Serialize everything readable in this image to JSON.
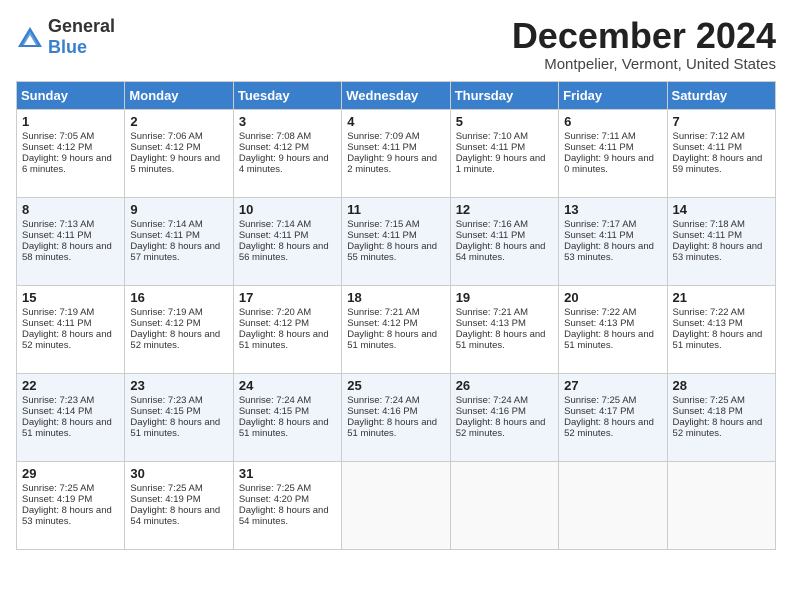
{
  "header": {
    "logo_general": "General",
    "logo_blue": "Blue",
    "month": "December 2024",
    "location": "Montpelier, Vermont, United States"
  },
  "days_of_week": [
    "Sunday",
    "Monday",
    "Tuesday",
    "Wednesday",
    "Thursday",
    "Friday",
    "Saturday"
  ],
  "weeks": [
    [
      {
        "day": 1,
        "sunrise": "Sunrise: 7:05 AM",
        "sunset": "Sunset: 4:12 PM",
        "daylight": "Daylight: 9 hours and 6 minutes."
      },
      {
        "day": 2,
        "sunrise": "Sunrise: 7:06 AM",
        "sunset": "Sunset: 4:12 PM",
        "daylight": "Daylight: 9 hours and 5 minutes."
      },
      {
        "day": 3,
        "sunrise": "Sunrise: 7:08 AM",
        "sunset": "Sunset: 4:12 PM",
        "daylight": "Daylight: 9 hours and 4 minutes."
      },
      {
        "day": 4,
        "sunrise": "Sunrise: 7:09 AM",
        "sunset": "Sunset: 4:11 PM",
        "daylight": "Daylight: 9 hours and 2 minutes."
      },
      {
        "day": 5,
        "sunrise": "Sunrise: 7:10 AM",
        "sunset": "Sunset: 4:11 PM",
        "daylight": "Daylight: 9 hours and 1 minute."
      },
      {
        "day": 6,
        "sunrise": "Sunrise: 7:11 AM",
        "sunset": "Sunset: 4:11 PM",
        "daylight": "Daylight: 9 hours and 0 minutes."
      },
      {
        "day": 7,
        "sunrise": "Sunrise: 7:12 AM",
        "sunset": "Sunset: 4:11 PM",
        "daylight": "Daylight: 8 hours and 59 minutes."
      }
    ],
    [
      {
        "day": 8,
        "sunrise": "Sunrise: 7:13 AM",
        "sunset": "Sunset: 4:11 PM",
        "daylight": "Daylight: 8 hours and 58 minutes."
      },
      {
        "day": 9,
        "sunrise": "Sunrise: 7:14 AM",
        "sunset": "Sunset: 4:11 PM",
        "daylight": "Daylight: 8 hours and 57 minutes."
      },
      {
        "day": 10,
        "sunrise": "Sunrise: 7:14 AM",
        "sunset": "Sunset: 4:11 PM",
        "daylight": "Daylight: 8 hours and 56 minutes."
      },
      {
        "day": 11,
        "sunrise": "Sunrise: 7:15 AM",
        "sunset": "Sunset: 4:11 PM",
        "daylight": "Daylight: 8 hours and 55 minutes."
      },
      {
        "day": 12,
        "sunrise": "Sunrise: 7:16 AM",
        "sunset": "Sunset: 4:11 PM",
        "daylight": "Daylight: 8 hours and 54 minutes."
      },
      {
        "day": 13,
        "sunrise": "Sunrise: 7:17 AM",
        "sunset": "Sunset: 4:11 PM",
        "daylight": "Daylight: 8 hours and 53 minutes."
      },
      {
        "day": 14,
        "sunrise": "Sunrise: 7:18 AM",
        "sunset": "Sunset: 4:11 PM",
        "daylight": "Daylight: 8 hours and 53 minutes."
      }
    ],
    [
      {
        "day": 15,
        "sunrise": "Sunrise: 7:19 AM",
        "sunset": "Sunset: 4:11 PM",
        "daylight": "Daylight: 8 hours and 52 minutes."
      },
      {
        "day": 16,
        "sunrise": "Sunrise: 7:19 AM",
        "sunset": "Sunset: 4:12 PM",
        "daylight": "Daylight: 8 hours and 52 minutes."
      },
      {
        "day": 17,
        "sunrise": "Sunrise: 7:20 AM",
        "sunset": "Sunset: 4:12 PM",
        "daylight": "Daylight: 8 hours and 51 minutes."
      },
      {
        "day": 18,
        "sunrise": "Sunrise: 7:21 AM",
        "sunset": "Sunset: 4:12 PM",
        "daylight": "Daylight: 8 hours and 51 minutes."
      },
      {
        "day": 19,
        "sunrise": "Sunrise: 7:21 AM",
        "sunset": "Sunset: 4:13 PM",
        "daylight": "Daylight: 8 hours and 51 minutes."
      },
      {
        "day": 20,
        "sunrise": "Sunrise: 7:22 AM",
        "sunset": "Sunset: 4:13 PM",
        "daylight": "Daylight: 8 hours and 51 minutes."
      },
      {
        "day": 21,
        "sunrise": "Sunrise: 7:22 AM",
        "sunset": "Sunset: 4:13 PM",
        "daylight": "Daylight: 8 hours and 51 minutes."
      }
    ],
    [
      {
        "day": 22,
        "sunrise": "Sunrise: 7:23 AM",
        "sunset": "Sunset: 4:14 PM",
        "daylight": "Daylight: 8 hours and 51 minutes."
      },
      {
        "day": 23,
        "sunrise": "Sunrise: 7:23 AM",
        "sunset": "Sunset: 4:15 PM",
        "daylight": "Daylight: 8 hours and 51 minutes."
      },
      {
        "day": 24,
        "sunrise": "Sunrise: 7:24 AM",
        "sunset": "Sunset: 4:15 PM",
        "daylight": "Daylight: 8 hours and 51 minutes."
      },
      {
        "day": 25,
        "sunrise": "Sunrise: 7:24 AM",
        "sunset": "Sunset: 4:16 PM",
        "daylight": "Daylight: 8 hours and 51 minutes."
      },
      {
        "day": 26,
        "sunrise": "Sunrise: 7:24 AM",
        "sunset": "Sunset: 4:16 PM",
        "daylight": "Daylight: 8 hours and 52 minutes."
      },
      {
        "day": 27,
        "sunrise": "Sunrise: 7:25 AM",
        "sunset": "Sunset: 4:17 PM",
        "daylight": "Daylight: 8 hours and 52 minutes."
      },
      {
        "day": 28,
        "sunrise": "Sunrise: 7:25 AM",
        "sunset": "Sunset: 4:18 PM",
        "daylight": "Daylight: 8 hours and 52 minutes."
      }
    ],
    [
      {
        "day": 29,
        "sunrise": "Sunrise: 7:25 AM",
        "sunset": "Sunset: 4:19 PM",
        "daylight": "Daylight: 8 hours and 53 minutes."
      },
      {
        "day": 30,
        "sunrise": "Sunrise: 7:25 AM",
        "sunset": "Sunset: 4:19 PM",
        "daylight": "Daylight: 8 hours and 54 minutes."
      },
      {
        "day": 31,
        "sunrise": "Sunrise: 7:25 AM",
        "sunset": "Sunset: 4:20 PM",
        "daylight": "Daylight: 8 hours and 54 minutes."
      },
      null,
      null,
      null,
      null
    ]
  ]
}
